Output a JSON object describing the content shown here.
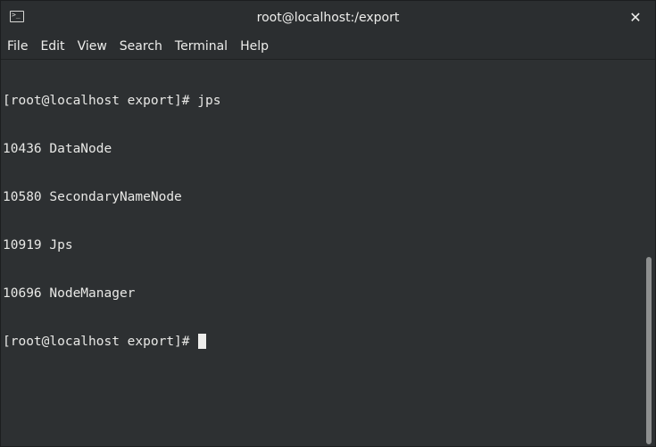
{
  "window": {
    "title": "root@localhost:/export",
    "close_glyph": "✕",
    "icon": "terminal-icon"
  },
  "menu": {
    "items": [
      {
        "label": "File"
      },
      {
        "label": "Edit"
      },
      {
        "label": "View"
      },
      {
        "label": "Search"
      },
      {
        "label": "Terminal"
      },
      {
        "label": "Help"
      }
    ]
  },
  "terminal": {
    "lines": [
      "[root@localhost export]# jps",
      "10436 DataNode",
      "10580 SecondaryNameNode",
      "10919 Jps",
      "10696 NodeManager"
    ],
    "prompt": "[root@localhost export]# "
  },
  "colors": {
    "background": "#2d3032",
    "text": "#e8e8e6",
    "cursor": "#ededeb"
  }
}
